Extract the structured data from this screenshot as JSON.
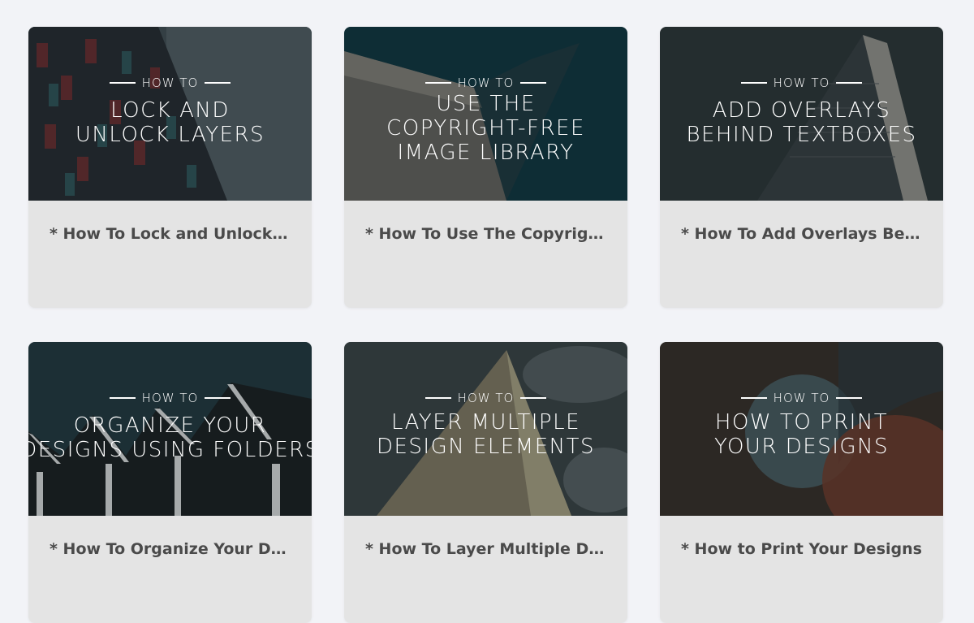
{
  "tutorials": [
    {
      "kicker": "HOW TO",
      "headline": "LOCK AND\nUNLOCK LAYERS",
      "caption": "* How To Lock and Unlock ..."
    },
    {
      "kicker": "HOW TO",
      "headline": "USE THE\nCOPYRIGHT-FREE\nIMAGE LIBRARY",
      "caption": "* How To Use The Copyrigh..."
    },
    {
      "kicker": "HOW TO",
      "headline": "ADD OVERLAYS\nBEHIND TEXTBOXES",
      "caption": "* How To Add Overlays Be..."
    },
    {
      "kicker": "HOW TO",
      "headline": "ORGANIZE YOUR\nDESIGNS USING FOLDERS",
      "caption": "* How To Organize Your De..."
    },
    {
      "kicker": "HOW TO",
      "headline": "LAYER MULTIPLE\nDESIGN ELEMENTS",
      "caption": "* How To Layer Multiple De..."
    },
    {
      "kicker": "HOW TO",
      "headline": "HOW TO PRINT\nYOUR DESIGNS",
      "caption": "* How to Print Your Designs"
    }
  ],
  "colors": {
    "page_background": "#f2f3f7",
    "caption_background": "#e4e4e4",
    "caption_text": "#4a4a4a"
  }
}
